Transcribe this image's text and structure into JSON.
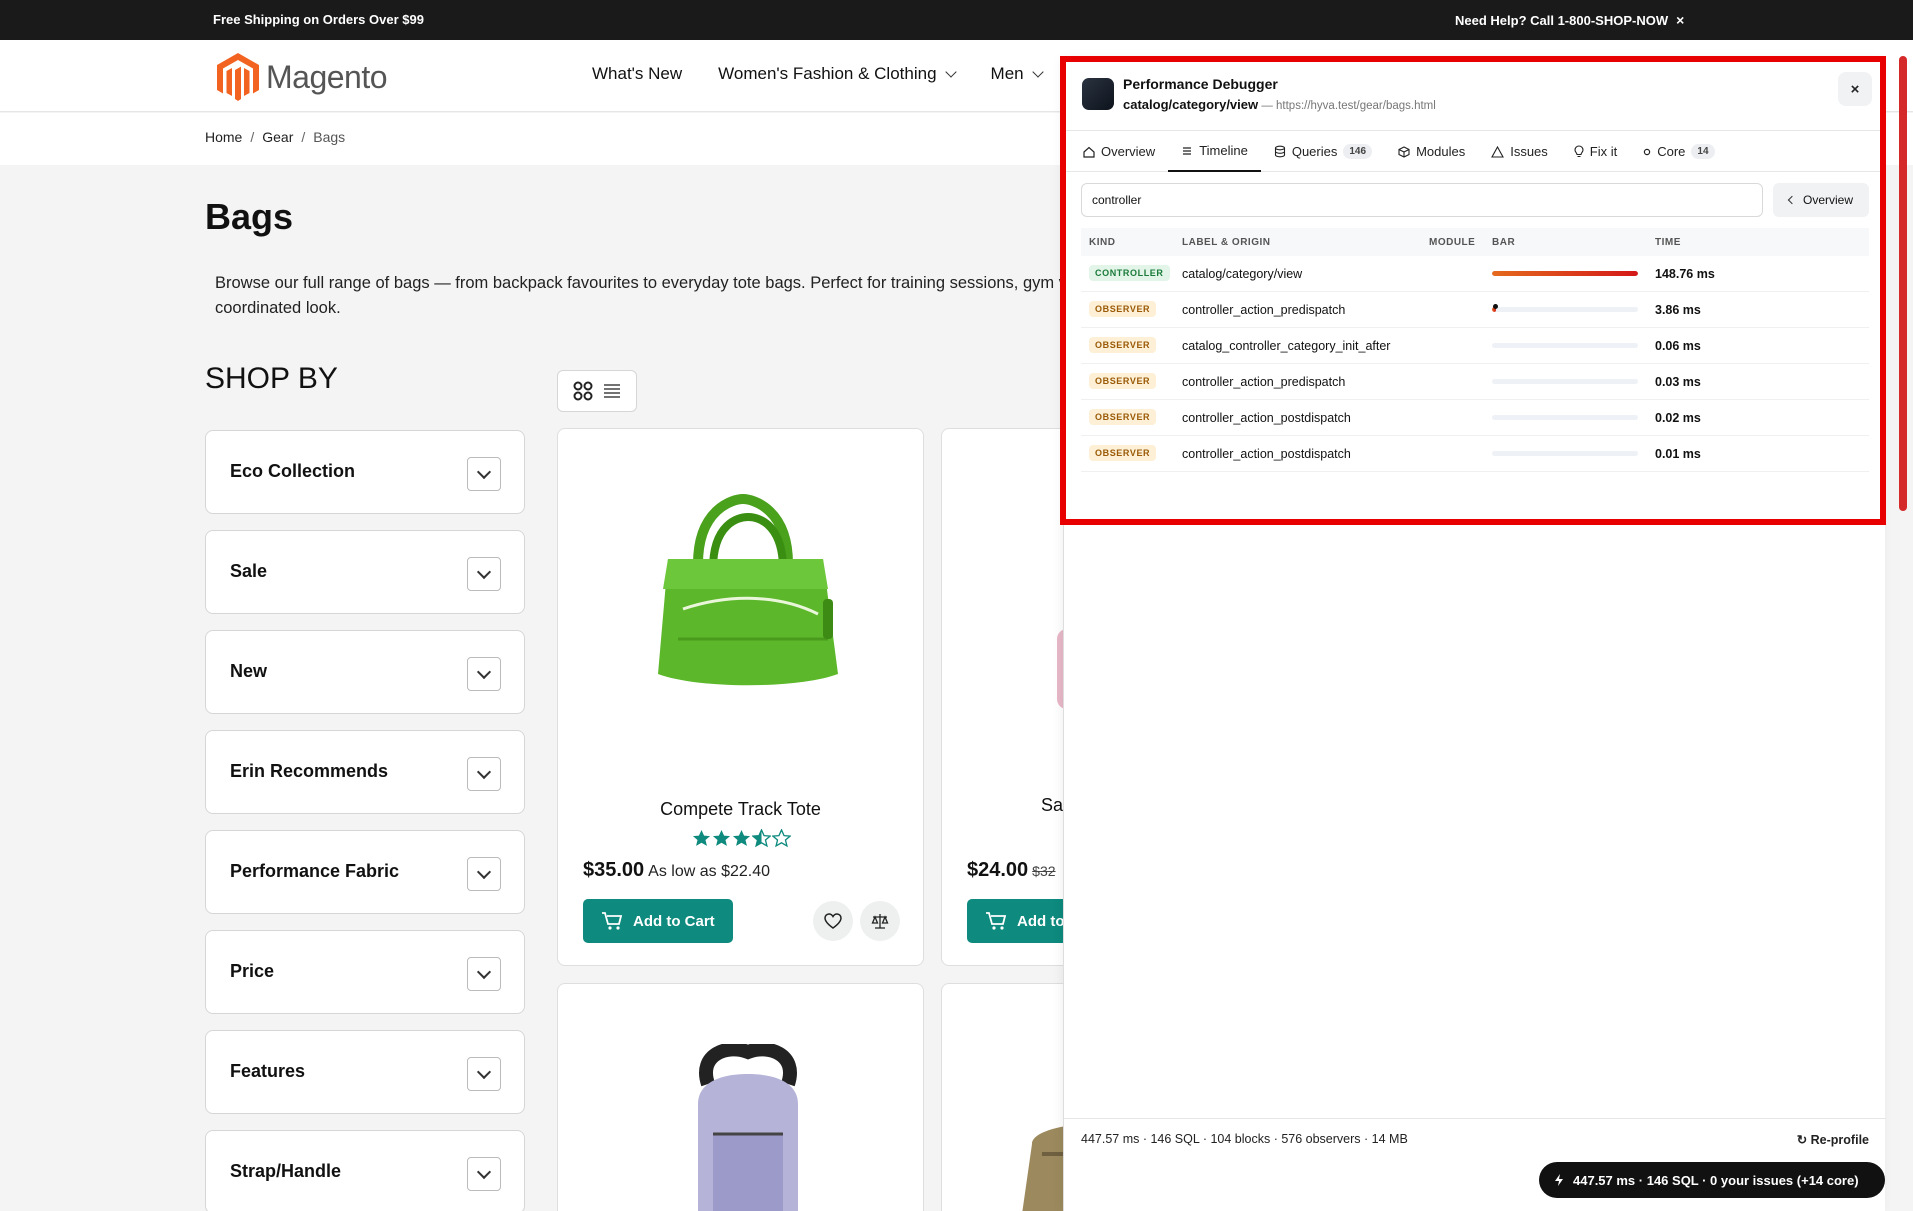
{
  "topbar": {
    "promo": "Free Shipping on Orders Over $99",
    "help": "Need Help? Call 1-800-SHOP-NOW",
    "close": "×"
  },
  "header": {
    "logo_text": "Magento",
    "nav": [
      {
        "label": "What's New",
        "dropdown": false
      },
      {
        "label": "Women's Fashion & Clothing",
        "dropdown": true
      },
      {
        "label": "Men",
        "dropdown": true
      }
    ]
  },
  "breadcrumb": {
    "items": [
      "Home",
      "Gear"
    ],
    "current": "Bags",
    "separator": "/"
  },
  "page": {
    "title": "Bags",
    "description_line1": "Browse our full range of bags — from backpack favourites to everyday tote bags. Perfect for training sessions, gym vi",
    "description_line2": "coordinated look."
  },
  "shopby": {
    "title": "SHOP BY",
    "filters": [
      "Eco Collection",
      "Sale",
      "New",
      "Erin Recommends",
      "Performance Fabric",
      "Price",
      "Features",
      "Strap/Handle"
    ]
  },
  "products": [
    {
      "name": "Compete Track Tote",
      "price": "$35.00",
      "as_low_as": "As low as $22.40",
      "rating": 3.5,
      "add_label": "Add to Cart"
    },
    {
      "name": "Sav",
      "price": "$24.00",
      "old_price": "$32",
      "add_label": "Add to C"
    }
  ],
  "debugger": {
    "title": "Performance Debugger",
    "route": "catalog/category/view",
    "url": "https://hyva.test/gear/bags.html",
    "url_prefix": " — ",
    "close": "×",
    "tabs": [
      {
        "label": "Overview",
        "icon": "home-icon"
      },
      {
        "label": "Timeline",
        "icon": "list-icon",
        "active": true
      },
      {
        "label": "Queries",
        "icon": "database-icon",
        "count": "146"
      },
      {
        "label": "Modules",
        "icon": "cube-icon"
      },
      {
        "label": "Issues",
        "icon": "warning-icon"
      },
      {
        "label": "Fix it",
        "icon": "bulb-icon"
      },
      {
        "label": "Core",
        "icon": "gear-icon",
        "count": "14"
      }
    ],
    "search_value": "controller",
    "overview_button": "Overview",
    "columns": {
      "kind": "KIND",
      "label": "LABEL & ORIGIN",
      "module": "MODULE",
      "bar": "BAR",
      "time": "TIME"
    },
    "rows": [
      {
        "kind": "CONTROLLER",
        "label": "catalog/category/view",
        "time": "148.76 ms",
        "bar_fraction": 1.0
      },
      {
        "kind": "OBSERVER",
        "label": "controller_action_predispatch",
        "time": "3.86 ms",
        "bar_fraction": 0.026
      },
      {
        "kind": "OBSERVER",
        "label": "catalog_controller_category_init_after",
        "time": "0.06 ms",
        "bar_fraction": 0
      },
      {
        "kind": "OBSERVER",
        "label": "controller_action_predispatch",
        "time": "0.03 ms",
        "bar_fraction": 0
      },
      {
        "kind": "OBSERVER",
        "label": "controller_action_postdispatch",
        "time": "0.02 ms",
        "bar_fraction": 0
      },
      {
        "kind": "OBSERVER",
        "label": "controller_action_postdispatch",
        "time": "0.01 ms",
        "bar_fraction": 0
      }
    ],
    "footer_stats": "447.57 ms · 146 SQL · 104 blocks · 576 observers · 14 MB",
    "reprofile": "Re-profile"
  },
  "summary_pill": "447.57 ms · 146 SQL · 0 your issues (+14 core)",
  "colors": {
    "accent": "#0e8a7e",
    "highlight": "#e80000",
    "topbar": "#1a1a1a",
    "logo": "#f26322"
  }
}
